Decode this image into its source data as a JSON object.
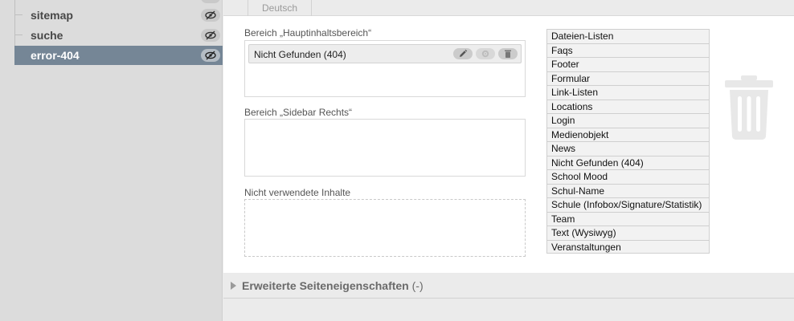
{
  "sidebar": {
    "items": [
      {
        "label": "sitemap"
      },
      {
        "label": "suche"
      },
      {
        "label": "error-404"
      }
    ]
  },
  "tabs": [
    {
      "label": "Deutsch"
    }
  ],
  "areas": {
    "main": {
      "label": "Bereich „Hauptinhaltsbereich“",
      "item": "Nicht Gefunden (404)"
    },
    "sidebar": {
      "label": "Bereich „Sidebar Rechts“"
    },
    "unused": {
      "label": "Nicht verwendete Inhalte"
    }
  },
  "content_types": [
    "Dateien-Listen",
    "Faqs",
    "Footer",
    "Formular",
    "Link-Listen",
    "Locations",
    "Login",
    "Medienobjekt",
    "News",
    "Nicht Gefunden (404)",
    "School Mood",
    "Schul-Name",
    "Schule (Infobox/Signature/Statistik)",
    "Team",
    "Text (Wysiwyg)",
    "Veranstaltungen"
  ],
  "footer": {
    "label": "Erweiterte Seiteneigenschaften",
    "suffix": "(-)"
  },
  "icons": {
    "visibility": "eye-slash-icon",
    "edit": "pencil-icon",
    "settings": "gear-icon",
    "delete": "trash-icon",
    "expand": "triangle-right-icon"
  }
}
